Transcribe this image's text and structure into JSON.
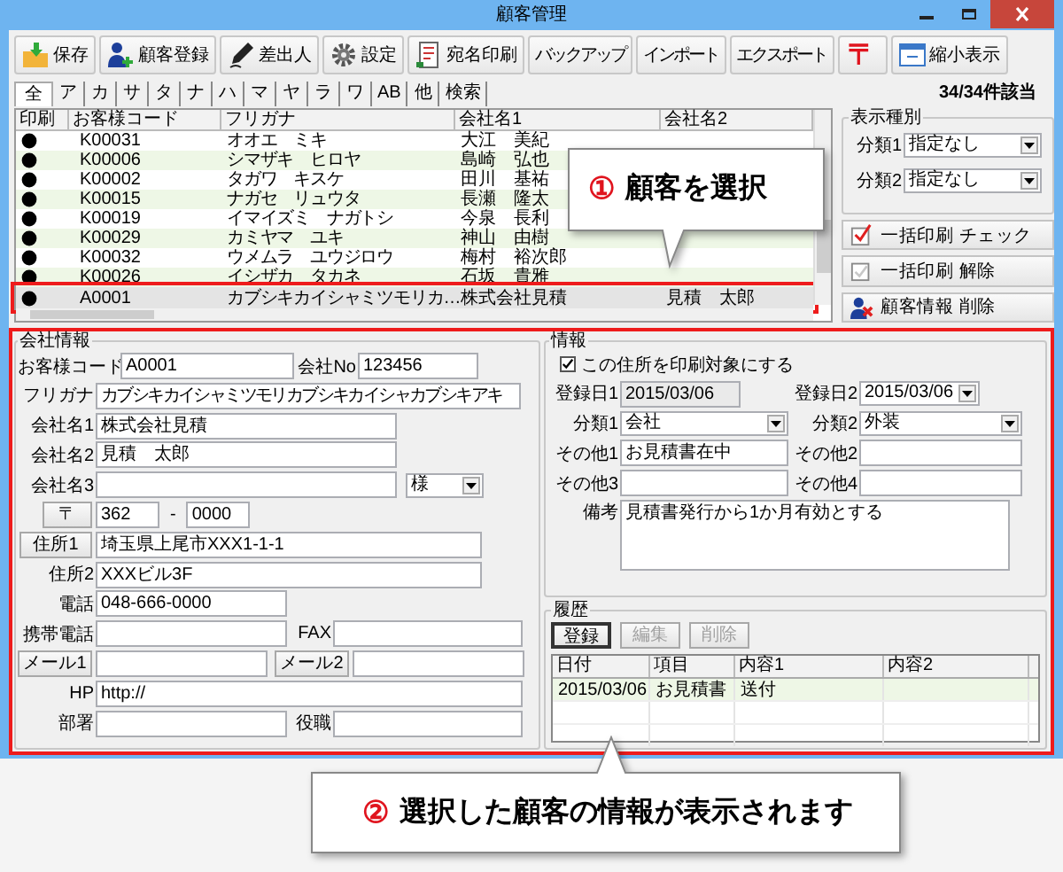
{
  "window": {
    "title": "顧客管理"
  },
  "toolbar": [
    {
      "label": "保存",
      "kind": "icon"
    },
    {
      "label": "顧客登録",
      "kind": "icon"
    },
    {
      "label": "差出人",
      "kind": "icon"
    },
    {
      "label": "設定",
      "kind": "icon"
    },
    {
      "label": "宛名印刷",
      "kind": "icon"
    },
    {
      "label": "バックアップ",
      "kind": "text"
    },
    {
      "label": "インポート",
      "kind": "text"
    },
    {
      "label": "エクスポート",
      "kind": "text"
    },
    {
      "label": "〒",
      "kind": "symbol"
    },
    {
      "label": "縮小表示",
      "kind": "icon"
    }
  ],
  "index_tabs": [
    {
      "label": "全",
      "selected": true
    },
    {
      "label": "ア",
      "selected": false
    },
    {
      "label": "カ",
      "selected": false
    },
    {
      "label": "サ",
      "selected": false
    },
    {
      "label": "タ",
      "selected": false
    },
    {
      "label": "ナ",
      "selected": false
    },
    {
      "label": "ハ",
      "selected": false
    },
    {
      "label": "マ",
      "selected": false
    },
    {
      "label": "ヤ",
      "selected": false
    },
    {
      "label": "ラ",
      "selected": false
    },
    {
      "label": "ワ",
      "selected": false
    },
    {
      "label": "AB",
      "selected": false
    },
    {
      "label": "他",
      "selected": false
    },
    {
      "label": "検索",
      "selected": false
    }
  ],
  "match_count": "34/34件該当",
  "customer_list": {
    "columns": [
      "印刷",
      "お客様コード",
      "フリガナ",
      "会社名1",
      "会社名2"
    ],
    "rows": [
      {
        "print": true,
        "code": "K00031",
        "furigana": "オオエ　ミキ",
        "name1": "大江　美紀",
        "selected": false
      },
      {
        "print": true,
        "code": "K00006",
        "furigana": "シマザキ　ヒロヤ",
        "name1": "島崎　弘也",
        "selected": false
      },
      {
        "print": true,
        "code": "K00002",
        "furigana": "タガワ　キスケ",
        "name1": "田川　基祐",
        "selected": false
      },
      {
        "print": true,
        "code": "K00015",
        "furigana": "ナガセ　リュウタ",
        "name1": "長瀬　隆太",
        "selected": false
      },
      {
        "print": true,
        "code": "K00019",
        "furigana": "イマイズミ　ナガトシ",
        "name1": "今泉　長利",
        "selected": false
      },
      {
        "print": true,
        "code": "K00029",
        "furigana": "カミヤマ　ユキ",
        "name1": "神山　由樹",
        "selected": false
      },
      {
        "print": true,
        "code": "K00032",
        "furigana": "ウメムラ　ユウジロウ",
        "name1": "梅村　裕次郎",
        "selected": false
      },
      {
        "print": true,
        "code": "K00026",
        "furigana": "イシザカ　タカネ",
        "name1": "石坂　貴雅",
        "selected": false
      },
      {
        "print": true,
        "code": "A0001",
        "furigana": "カブシキカイシャミツモリカ…",
        "name1": "株式会社見積",
        "name2": "見積　太郎",
        "selected": true
      }
    ]
  },
  "filter": {
    "title": "表示種別",
    "fields": [
      {
        "label": "分類1",
        "value": "指定なし"
      },
      {
        "label": "分類2",
        "value": "指定なし"
      }
    ]
  },
  "actions": [
    {
      "label": "一括印刷 チェック"
    },
    {
      "label": "一括印刷 解除"
    },
    {
      "label": "顧客情報 削除"
    }
  ],
  "company_info": {
    "title": "会社情報",
    "customer_code": {
      "label": "お客様コード",
      "value": "A0001"
    },
    "company_no": {
      "label": "会社No",
      "value": "123456"
    },
    "furigana": {
      "label": "フリガナ",
      "value": "カブシキカイシャミツモリカブシキカイシャカブシキアキ"
    },
    "name1": {
      "label": "会社名1",
      "value": "株式会社見積"
    },
    "name2": {
      "label": "会社名2",
      "value": "見積　太郎"
    },
    "name3": {
      "label": "会社名3",
      "honorific": "様"
    },
    "postal": {
      "button": "〒",
      "first": "362",
      "separator": "-",
      "second": "0000"
    },
    "address1": {
      "button": "住所1",
      "value": "埼玉県上尾市XXX1-1-1"
    },
    "address2": {
      "label": "住所2",
      "value": "XXXビル3F"
    },
    "phone": {
      "label": "電話",
      "value": "048-666-0000"
    },
    "mobile": {
      "label": "携帯電話"
    },
    "fax": {
      "label": "FAX"
    },
    "mail1": {
      "button": "メール1"
    },
    "mail2": {
      "button": "メール2"
    },
    "hp": {
      "label": "HP",
      "value": "http://"
    },
    "department": {
      "label": "部署"
    },
    "position": {
      "label": "役職"
    }
  },
  "info": {
    "title": "情報",
    "print_address": {
      "label": "この住所を印刷対象にする",
      "checked": true
    },
    "reg_date1": {
      "label": "登録日1",
      "value": "2015/03/06"
    },
    "reg_date2": {
      "label": "登録日2",
      "value": "2015/03/06"
    },
    "category1": {
      "label": "分類1",
      "value": "会社"
    },
    "category2": {
      "label": "分類2",
      "value": "外装"
    },
    "other1": {
      "label": "その他1",
      "value": "お見積書在中"
    },
    "other2": {
      "label": "その他2"
    },
    "other3": {
      "label": "その他3"
    },
    "other4": {
      "label": "その他4"
    },
    "note": {
      "label": "備考",
      "value": "見積書発行から1か月有効とする"
    }
  },
  "history": {
    "title": "履歴",
    "buttons": [
      {
        "label": "登録",
        "disabled": false
      },
      {
        "label": "編集",
        "disabled": true
      },
      {
        "label": "削除",
        "disabled": true
      }
    ],
    "columns": [
      "日付",
      "項目",
      "内容1",
      "内容2"
    ],
    "rows": [
      {
        "date": "2015/03/06",
        "item": "お見積書",
        "content1": "送付"
      }
    ]
  },
  "callouts": [
    {
      "number": "①",
      "text": "顧客を選択"
    },
    {
      "number": "②",
      "text": "選択した顧客の情報が表示されます"
    }
  ]
}
